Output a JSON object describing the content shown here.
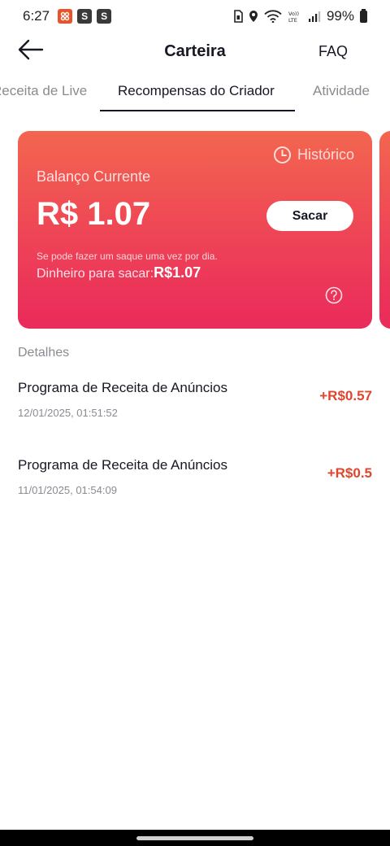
{
  "status_bar": {
    "time": "6:27",
    "battery": "99%",
    "app_icons": [
      "app-notification-icon",
      "s-icon",
      "s-icon"
    ],
    "badge_letters": [
      "S",
      "S"
    ]
  },
  "header": {
    "title": "Carteira",
    "faq_label": "FAQ"
  },
  "tabs": [
    {
      "label": "Receita de Live",
      "active": false
    },
    {
      "label": "Recompensas do Criador",
      "active": true
    },
    {
      "label": "Atividade",
      "active": false
    }
  ],
  "card": {
    "history_label": "Histórico",
    "balance_label": "Balanço Currente",
    "balance": "R$ 1.07",
    "withdraw_label": "Sacar",
    "note": "Se pode fazer um saque uma vez por dia.",
    "withdrawable_label": "Dinheiro para sacar:",
    "withdrawable_amount": "R$1.07",
    "gradient_colors": [
      "#f3664f",
      "#ea2a5b"
    ]
  },
  "details": {
    "title": "Detalhes",
    "transactions": [
      {
        "name": "Programa de Receita de Anúncios",
        "date": "12/01/2025, 01:51:52",
        "amount": "+R$0.57"
      },
      {
        "name": "Programa de Receita de Anúncios",
        "date": "11/01/2025, 01:54:09",
        "amount": "+R$0.5"
      }
    ]
  },
  "colors": {
    "accent_amount": "#e0462e",
    "text_primary": "#161823",
    "text_secondary": "#8a8b91"
  }
}
